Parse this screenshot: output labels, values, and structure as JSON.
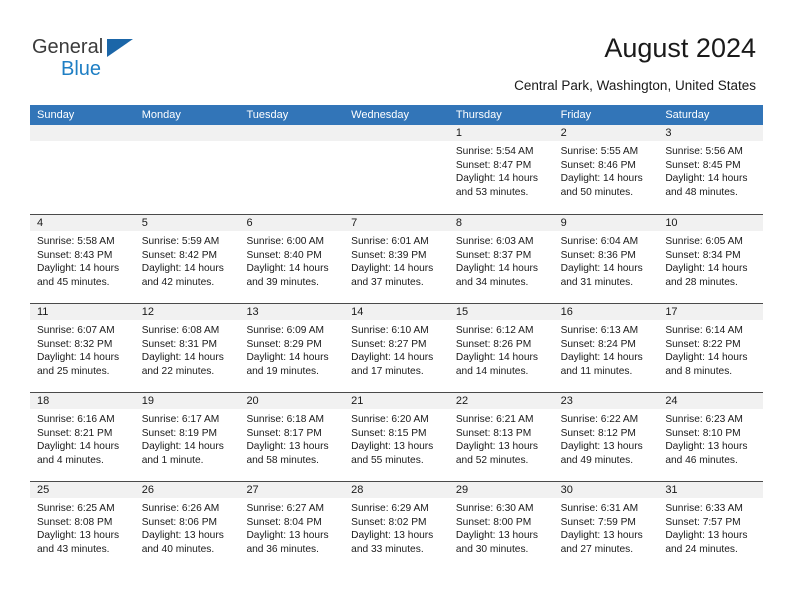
{
  "brand": {
    "line1": "General",
    "line2": "Blue",
    "accent": "#1f7fc4",
    "triangle_color": "#1b66a8"
  },
  "header": {
    "title": "August 2024",
    "subtitle": "Central Park, Washington, United States"
  },
  "calendar": {
    "header_bg": "#3275b8",
    "numband_bg": "#f1f1f1",
    "weekday_headers": [
      "Sunday",
      "Monday",
      "Tuesday",
      "Wednesday",
      "Thursday",
      "Friday",
      "Saturday"
    ],
    "labels": {
      "sunrise": "Sunrise:",
      "sunset": "Sunset:",
      "daylight": "Daylight:"
    },
    "weeks": [
      [
        {
          "day": "",
          "empty": true
        },
        {
          "day": "",
          "empty": true
        },
        {
          "day": "",
          "empty": true
        },
        {
          "day": "",
          "empty": true
        },
        {
          "day": "1",
          "sunrise": "Sunrise: 5:54 AM",
          "sunset": "Sunset: 8:47 PM",
          "daylight_1": "Daylight: 14 hours",
          "daylight_2": "and 53 minutes."
        },
        {
          "day": "2",
          "sunrise": "Sunrise: 5:55 AM",
          "sunset": "Sunset: 8:46 PM",
          "daylight_1": "Daylight: 14 hours",
          "daylight_2": "and 50 minutes."
        },
        {
          "day": "3",
          "sunrise": "Sunrise: 5:56 AM",
          "sunset": "Sunset: 8:45 PM",
          "daylight_1": "Daylight: 14 hours",
          "daylight_2": "and 48 minutes."
        }
      ],
      [
        {
          "day": "4",
          "sunrise": "Sunrise: 5:58 AM",
          "sunset": "Sunset: 8:43 PM",
          "daylight_1": "Daylight: 14 hours",
          "daylight_2": "and 45 minutes."
        },
        {
          "day": "5",
          "sunrise": "Sunrise: 5:59 AM",
          "sunset": "Sunset: 8:42 PM",
          "daylight_1": "Daylight: 14 hours",
          "daylight_2": "and 42 minutes."
        },
        {
          "day": "6",
          "sunrise": "Sunrise: 6:00 AM",
          "sunset": "Sunset: 8:40 PM",
          "daylight_1": "Daylight: 14 hours",
          "daylight_2": "and 39 minutes."
        },
        {
          "day": "7",
          "sunrise": "Sunrise: 6:01 AM",
          "sunset": "Sunset: 8:39 PM",
          "daylight_1": "Daylight: 14 hours",
          "daylight_2": "and 37 minutes."
        },
        {
          "day": "8",
          "sunrise": "Sunrise: 6:03 AM",
          "sunset": "Sunset: 8:37 PM",
          "daylight_1": "Daylight: 14 hours",
          "daylight_2": "and 34 minutes."
        },
        {
          "day": "9",
          "sunrise": "Sunrise: 6:04 AM",
          "sunset": "Sunset: 8:36 PM",
          "daylight_1": "Daylight: 14 hours",
          "daylight_2": "and 31 minutes."
        },
        {
          "day": "10",
          "sunrise": "Sunrise: 6:05 AM",
          "sunset": "Sunset: 8:34 PM",
          "daylight_1": "Daylight: 14 hours",
          "daylight_2": "and 28 minutes."
        }
      ],
      [
        {
          "day": "11",
          "sunrise": "Sunrise: 6:07 AM",
          "sunset": "Sunset: 8:32 PM",
          "daylight_1": "Daylight: 14 hours",
          "daylight_2": "and 25 minutes."
        },
        {
          "day": "12",
          "sunrise": "Sunrise: 6:08 AM",
          "sunset": "Sunset: 8:31 PM",
          "daylight_1": "Daylight: 14 hours",
          "daylight_2": "and 22 minutes."
        },
        {
          "day": "13",
          "sunrise": "Sunrise: 6:09 AM",
          "sunset": "Sunset: 8:29 PM",
          "daylight_1": "Daylight: 14 hours",
          "daylight_2": "and 19 minutes."
        },
        {
          "day": "14",
          "sunrise": "Sunrise: 6:10 AM",
          "sunset": "Sunset: 8:27 PM",
          "daylight_1": "Daylight: 14 hours",
          "daylight_2": "and 17 minutes."
        },
        {
          "day": "15",
          "sunrise": "Sunrise: 6:12 AM",
          "sunset": "Sunset: 8:26 PM",
          "daylight_1": "Daylight: 14 hours",
          "daylight_2": "and 14 minutes."
        },
        {
          "day": "16",
          "sunrise": "Sunrise: 6:13 AM",
          "sunset": "Sunset: 8:24 PM",
          "daylight_1": "Daylight: 14 hours",
          "daylight_2": "and 11 minutes."
        },
        {
          "day": "17",
          "sunrise": "Sunrise: 6:14 AM",
          "sunset": "Sunset: 8:22 PM",
          "daylight_1": "Daylight: 14 hours",
          "daylight_2": "and 8 minutes."
        }
      ],
      [
        {
          "day": "18",
          "sunrise": "Sunrise: 6:16 AM",
          "sunset": "Sunset: 8:21 PM",
          "daylight_1": "Daylight: 14 hours",
          "daylight_2": "and 4 minutes."
        },
        {
          "day": "19",
          "sunrise": "Sunrise: 6:17 AM",
          "sunset": "Sunset: 8:19 PM",
          "daylight_1": "Daylight: 14 hours",
          "daylight_2": "and 1 minute."
        },
        {
          "day": "20",
          "sunrise": "Sunrise: 6:18 AM",
          "sunset": "Sunset: 8:17 PM",
          "daylight_1": "Daylight: 13 hours",
          "daylight_2": "and 58 minutes."
        },
        {
          "day": "21",
          "sunrise": "Sunrise: 6:20 AM",
          "sunset": "Sunset: 8:15 PM",
          "daylight_1": "Daylight: 13 hours",
          "daylight_2": "and 55 minutes."
        },
        {
          "day": "22",
          "sunrise": "Sunrise: 6:21 AM",
          "sunset": "Sunset: 8:13 PM",
          "daylight_1": "Daylight: 13 hours",
          "daylight_2": "and 52 minutes."
        },
        {
          "day": "23",
          "sunrise": "Sunrise: 6:22 AM",
          "sunset": "Sunset: 8:12 PM",
          "daylight_1": "Daylight: 13 hours",
          "daylight_2": "and 49 minutes."
        },
        {
          "day": "24",
          "sunrise": "Sunrise: 6:23 AM",
          "sunset": "Sunset: 8:10 PM",
          "daylight_1": "Daylight: 13 hours",
          "daylight_2": "and 46 minutes."
        }
      ],
      [
        {
          "day": "25",
          "sunrise": "Sunrise: 6:25 AM",
          "sunset": "Sunset: 8:08 PM",
          "daylight_1": "Daylight: 13 hours",
          "daylight_2": "and 43 minutes."
        },
        {
          "day": "26",
          "sunrise": "Sunrise: 6:26 AM",
          "sunset": "Sunset: 8:06 PM",
          "daylight_1": "Daylight: 13 hours",
          "daylight_2": "and 40 minutes."
        },
        {
          "day": "27",
          "sunrise": "Sunrise: 6:27 AM",
          "sunset": "Sunset: 8:04 PM",
          "daylight_1": "Daylight: 13 hours",
          "daylight_2": "and 36 minutes."
        },
        {
          "day": "28",
          "sunrise": "Sunrise: 6:29 AM",
          "sunset": "Sunset: 8:02 PM",
          "daylight_1": "Daylight: 13 hours",
          "daylight_2": "and 33 minutes."
        },
        {
          "day": "29",
          "sunrise": "Sunrise: 6:30 AM",
          "sunset": "Sunset: 8:00 PM",
          "daylight_1": "Daylight: 13 hours",
          "daylight_2": "and 30 minutes."
        },
        {
          "day": "30",
          "sunrise": "Sunrise: 6:31 AM",
          "sunset": "Sunset: 7:59 PM",
          "daylight_1": "Daylight: 13 hours",
          "daylight_2": "and 27 minutes."
        },
        {
          "day": "31",
          "sunrise": "Sunrise: 6:33 AM",
          "sunset": "Sunset: 7:57 PM",
          "daylight_1": "Daylight: 13 hours",
          "daylight_2": "and 24 minutes."
        }
      ]
    ]
  }
}
